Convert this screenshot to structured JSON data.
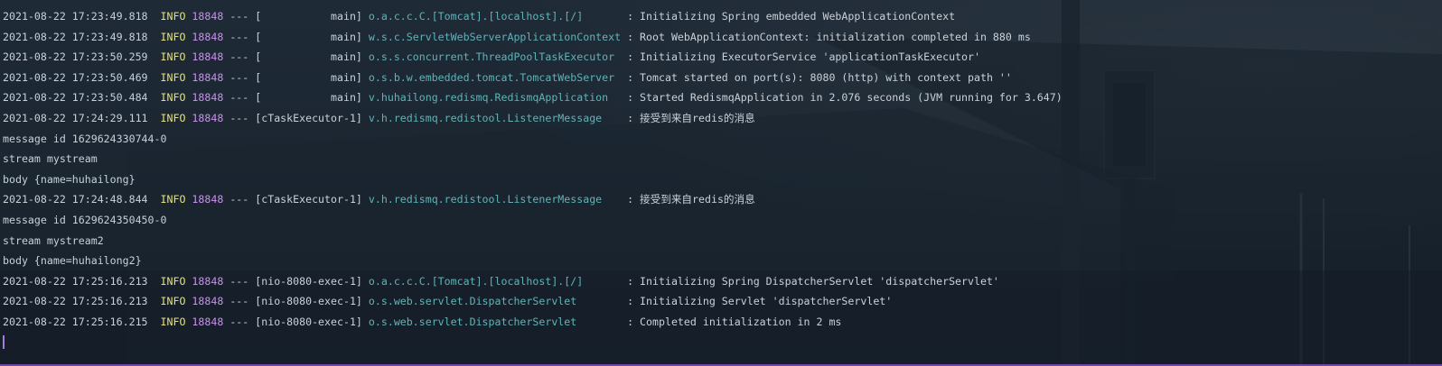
{
  "console": {
    "log_lines": [
      {
        "ts": "2021-08-22 17:23:49.818",
        "level": "INFO",
        "pid": "18848",
        "sep": "---",
        "thread": "[           main]",
        "logger": "o.a.c.c.C.[Tomcat].[localhost].[/]      ",
        "message": ": Initializing Spring embedded WebApplicationContext"
      },
      {
        "ts": "2021-08-22 17:23:49.818",
        "level": "INFO",
        "pid": "18848",
        "sep": "---",
        "thread": "[           main]",
        "logger": "w.s.c.ServletWebServerApplicationContext",
        "message": ": Root WebApplicationContext: initialization completed in 880 ms"
      },
      {
        "ts": "2021-08-22 17:23:50.259",
        "level": "INFO",
        "pid": "18848",
        "sep": "---",
        "thread": "[           main]",
        "logger": "o.s.s.concurrent.ThreadPoolTaskExecutor ",
        "message": ": Initializing ExecutorService 'applicationTaskExecutor'"
      },
      {
        "ts": "2021-08-22 17:23:50.469",
        "level": "INFO",
        "pid": "18848",
        "sep": "---",
        "thread": "[           main]",
        "logger": "o.s.b.w.embedded.tomcat.TomcatWebServer ",
        "message": ": Tomcat started on port(s): 8080 (http) with context path ''"
      },
      {
        "ts": "2021-08-22 17:23:50.484",
        "level": "INFO",
        "pid": "18848",
        "sep": "---",
        "thread": "[           main]",
        "logger": "v.huhailong.redismq.RedismqApplication  ",
        "message": ": Started RedismqApplication in 2.076 seconds (JVM running for 3.647)"
      },
      {
        "ts": "2021-08-22 17:24:29.111",
        "level": "INFO",
        "pid": "18848",
        "sep": "---",
        "thread": "[cTaskExecutor-1]",
        "logger": "v.h.redismq.redistool.ListenerMessage   ",
        "message": ": 接受到来自redis的消息"
      }
    ],
    "plain_1": [
      "message id 1629624330744-0",
      "stream mystream",
      "body {name=huhailong}"
    ],
    "log_line_7": {
      "ts": "2021-08-22 17:24:48.844",
      "level": "INFO",
      "pid": "18848",
      "sep": "---",
      "thread": "[cTaskExecutor-1]",
      "logger": "v.h.redismq.redistool.ListenerMessage   ",
      "message": ": 接受到来自redis的消息"
    },
    "plain_2": [
      "message id 1629624350450-0",
      "stream mystream2",
      "body {name=huhailong2}"
    ],
    "log_lines_2": [
      {
        "ts": "2021-08-22 17:25:16.213",
        "level": "INFO",
        "pid": "18848",
        "sep": "---",
        "thread": "[nio-8080-exec-1]",
        "logger": "o.a.c.c.C.[Tomcat].[localhost].[/]      ",
        "message": ": Initializing Spring DispatcherServlet 'dispatcherServlet'"
      },
      {
        "ts": "2021-08-22 17:25:16.213",
        "level": "INFO",
        "pid": "18848",
        "sep": "---",
        "thread": "[nio-8080-exec-1]",
        "logger": "o.s.web.servlet.DispatcherServlet       ",
        "message": ": Initializing Servlet 'dispatcherServlet'"
      },
      {
        "ts": "2021-08-22 17:25:16.215",
        "level": "INFO",
        "pid": "18848",
        "sep": "---",
        "thread": "[nio-8080-exec-1]",
        "logger": "o.s.web.servlet.DispatcherServlet       ",
        "message": ": Completed initialization in 2 ms"
      }
    ]
  },
  "colors": {
    "level": "#e5e07a",
    "pid": "#c792ea",
    "logger": "#5fb4b8",
    "text": "#c9d1d9",
    "cursor": "#a77bd8"
  }
}
